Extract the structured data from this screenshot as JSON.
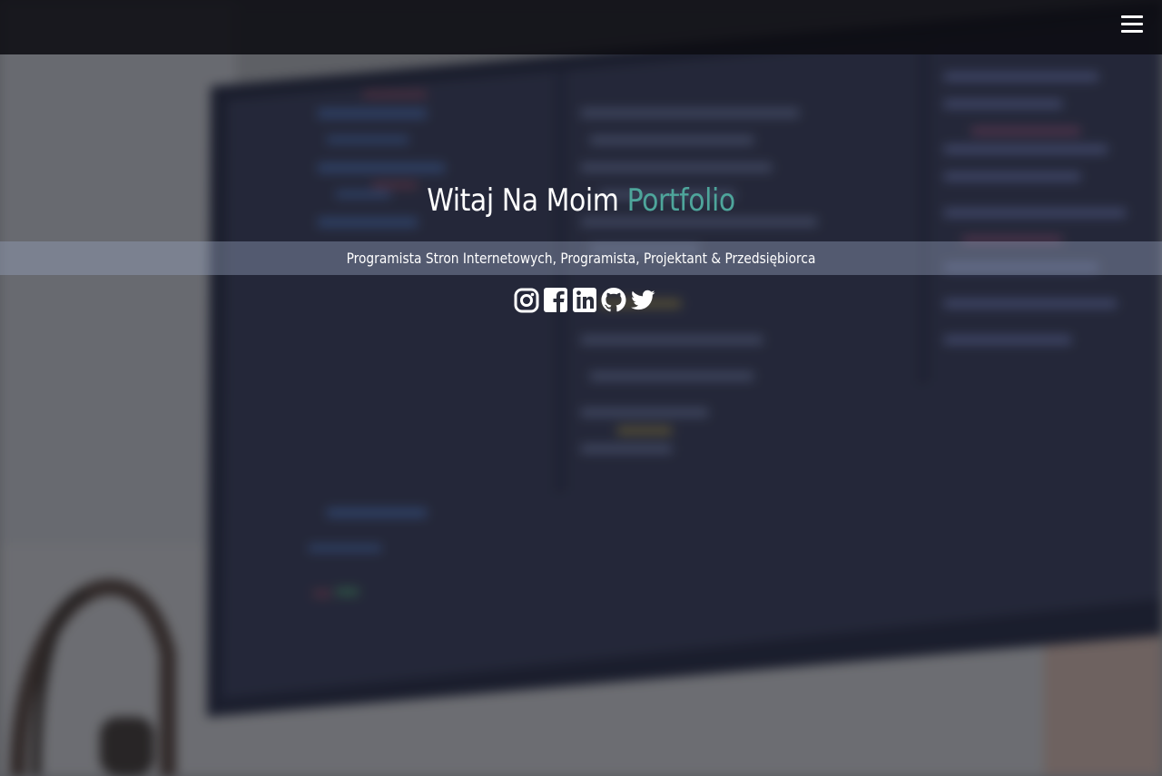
{
  "header": {
    "menu_icon": "hamburger-menu-icon"
  },
  "hero": {
    "title_main": "Witaj Na Moim ",
    "title_accent": "Portfolio",
    "subtitle": "Programista Stron Internetowych, Programista, Projektant & Przedsiębiorca",
    "accent_color": "#4ea59b"
  },
  "social": [
    {
      "icon": "instagram-icon"
    },
    {
      "icon": "facebook-icon"
    },
    {
      "icon": "linkedin-icon"
    },
    {
      "icon": "github-icon"
    },
    {
      "icon": "twitter-icon"
    }
  ]
}
